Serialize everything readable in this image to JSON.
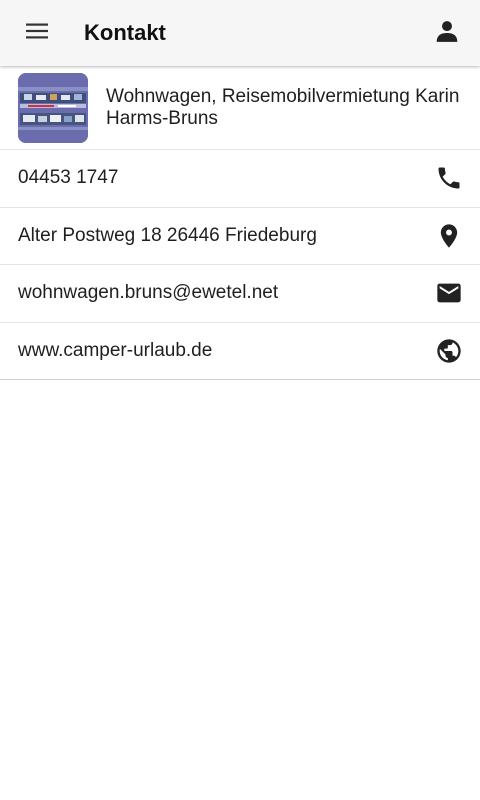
{
  "appbar": {
    "title": "Kontakt",
    "menu_icon": "hamburger-menu-icon",
    "profile_icon": "person-icon"
  },
  "company": {
    "name": "Wohnwagen, Reisemobilvermietung Karin Harms-Bruns"
  },
  "contacts": [
    {
      "text": "04453 1747",
      "icon": "phone-icon"
    },
    {
      "text": "Alter Postweg 18 26446 Friedeburg",
      "icon": "location-pin-icon"
    },
    {
      "text": "wohnwagen.bruns@ewetel.net",
      "icon": "mail-icon"
    },
    {
      "text": "www.camper-urlaub.de",
      "icon": "globe-icon"
    }
  ],
  "colors": {
    "appbar_bg": "#f6f6f6",
    "icon": "#222222",
    "logo_bg": "#6a6cae"
  }
}
